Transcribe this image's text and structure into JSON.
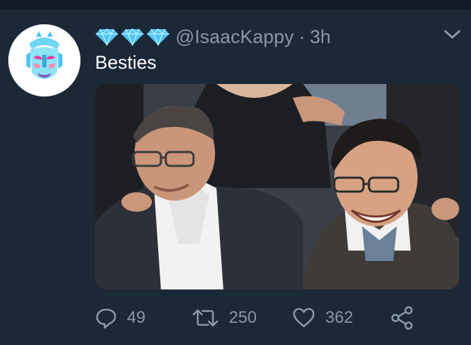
{
  "tweet": {
    "handle": "@IsaacKappy",
    "separator": "·",
    "time": "3h",
    "text": "Besties",
    "badges": [
      "gem-icon",
      "gem-icon",
      "gem-icon"
    ],
    "media": {
      "kind": "photo",
      "subject": "two smiling men in suits with arms around each other"
    }
  },
  "actions": {
    "reply": {
      "icon": "reply-icon",
      "count": "49"
    },
    "retweet": {
      "icon": "retweet-icon",
      "count": "250"
    },
    "like": {
      "icon": "heart-icon",
      "count": "362"
    },
    "share": {
      "icon": "share-icon"
    }
  },
  "colors": {
    "background": "#1b2836",
    "secondary_text": "#8899a6",
    "primary_text": "#ffffff",
    "gem": "#4fc3f7"
  }
}
